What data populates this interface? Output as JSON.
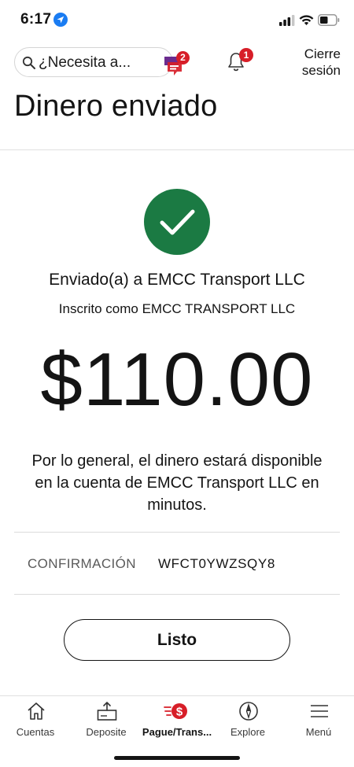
{
  "status_bar": {
    "time": "6:17"
  },
  "header": {
    "search_placeholder": "¿Necesita a...",
    "assistant_badge": "2",
    "notifications_badge": "1",
    "logout_line1": "Cierre",
    "logout_line2": "sesión"
  },
  "page": {
    "title": "Dinero enviado",
    "sent_to": "Enviado(a) a EMCC Transport LLC",
    "enrolled_as": "Inscrito como EMCC TRANSPORT LLC",
    "amount": "$110.00",
    "note": "Por lo general, el dinero estará disponible en la cuenta de EMCC Transport LLC en minutos.",
    "confirmation_label": "CONFIRMACIÓN",
    "confirmation_value": "WFCT0YWZSQY8",
    "done_label": "Listo"
  },
  "nav": {
    "items": [
      {
        "label": "Cuentas",
        "icon": "home-icon",
        "active": false
      },
      {
        "label": "Deposite",
        "icon": "deposit-icon",
        "active": false
      },
      {
        "label": "Pague/Trans...",
        "icon": "pay-transfer-icon",
        "active": true
      },
      {
        "label": "Explore",
        "icon": "compass-icon",
        "active": false
      },
      {
        "label": "Menú",
        "icon": "menu-icon",
        "active": false
      }
    ]
  },
  "colors": {
    "success_green": "#1b7a43",
    "badge_red": "#d71e28",
    "assistant_purple": "#6b2c8f"
  }
}
